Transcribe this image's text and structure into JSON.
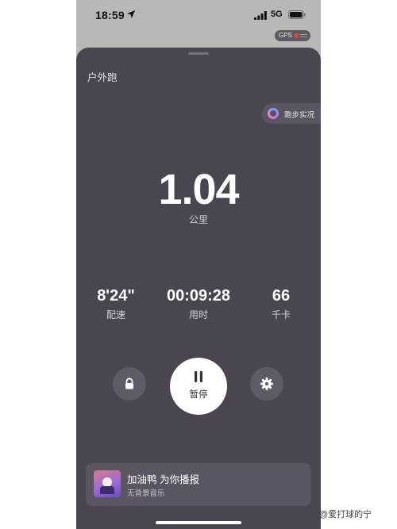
{
  "status_bar": {
    "time": "18:59",
    "network": "5G"
  },
  "gps": {
    "label": "GPS"
  },
  "sheet": {
    "title": "户外跑",
    "live_label": "跑步实况"
  },
  "distance": {
    "value": "1.04",
    "unit": "公里"
  },
  "metrics": [
    {
      "value": "8'24\"",
      "label": "配速"
    },
    {
      "value": "00:09:28",
      "label": "用时"
    },
    {
      "value": "66",
      "label": "千卡"
    }
  ],
  "controls": {
    "pause_label": "暂停"
  },
  "music": {
    "title": "加油鸭 为你播报",
    "subtitle": "无背景音乐"
  },
  "watermark": "@爱打球的宁",
  "icons": {
    "location": "location-arrow-icon",
    "signal": "cellular-signal-icon",
    "battery": "battery-icon",
    "lock": "lock-icon",
    "settings": "gear-icon",
    "pause": "pause-icon",
    "live": "ring-icon"
  }
}
